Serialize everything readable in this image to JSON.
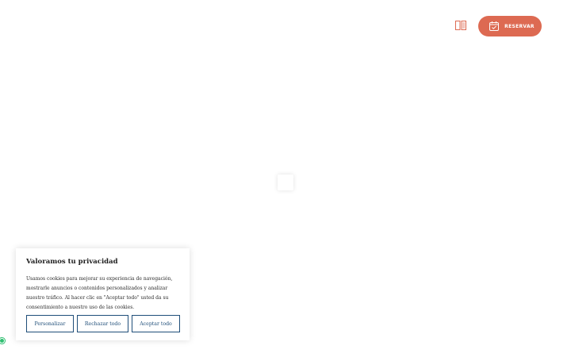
{
  "header": {
    "menu_icon": "book-menu-icon",
    "reserve_label": "RESERVAR",
    "reserve_icon": "calendar-check-icon",
    "accent_color": "#dd6a52"
  },
  "cookie_banner": {
    "title": "Valoramos tu privacidad",
    "text": "Usamos cookies para mejorar su experiencia de navegación, mostrarle anuncios o contenidos personalizados y analizar nuestro tráfico. Al hacer clic en \"Aceptar todo\" usted da su consentimiento a nuestro uso de las cookies.",
    "buttons": {
      "customize": "Personalizar",
      "reject": "Rechazar todo",
      "accept": "Aceptar todo"
    },
    "button_color": "#1f4e79"
  },
  "badge": {
    "icon": "cookie-settings-icon",
    "color": "#2fbf71"
  }
}
